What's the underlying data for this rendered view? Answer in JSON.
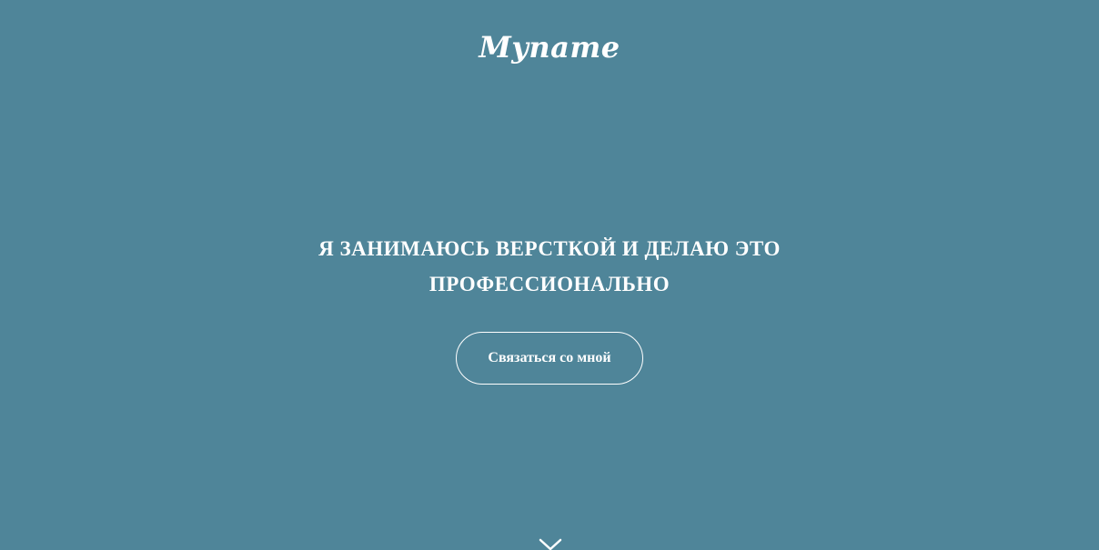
{
  "header": {
    "logo_text": "Myname"
  },
  "hero": {
    "headline_line1": "Я занимаюсь версткой и делаю это",
    "headline_line2": "профессионально",
    "cta_label": "Связаться со мной"
  },
  "icons": {
    "scroll_down": "chevron-down-icon"
  },
  "colors": {
    "background": "#4f8599",
    "text": "#ffffff"
  }
}
